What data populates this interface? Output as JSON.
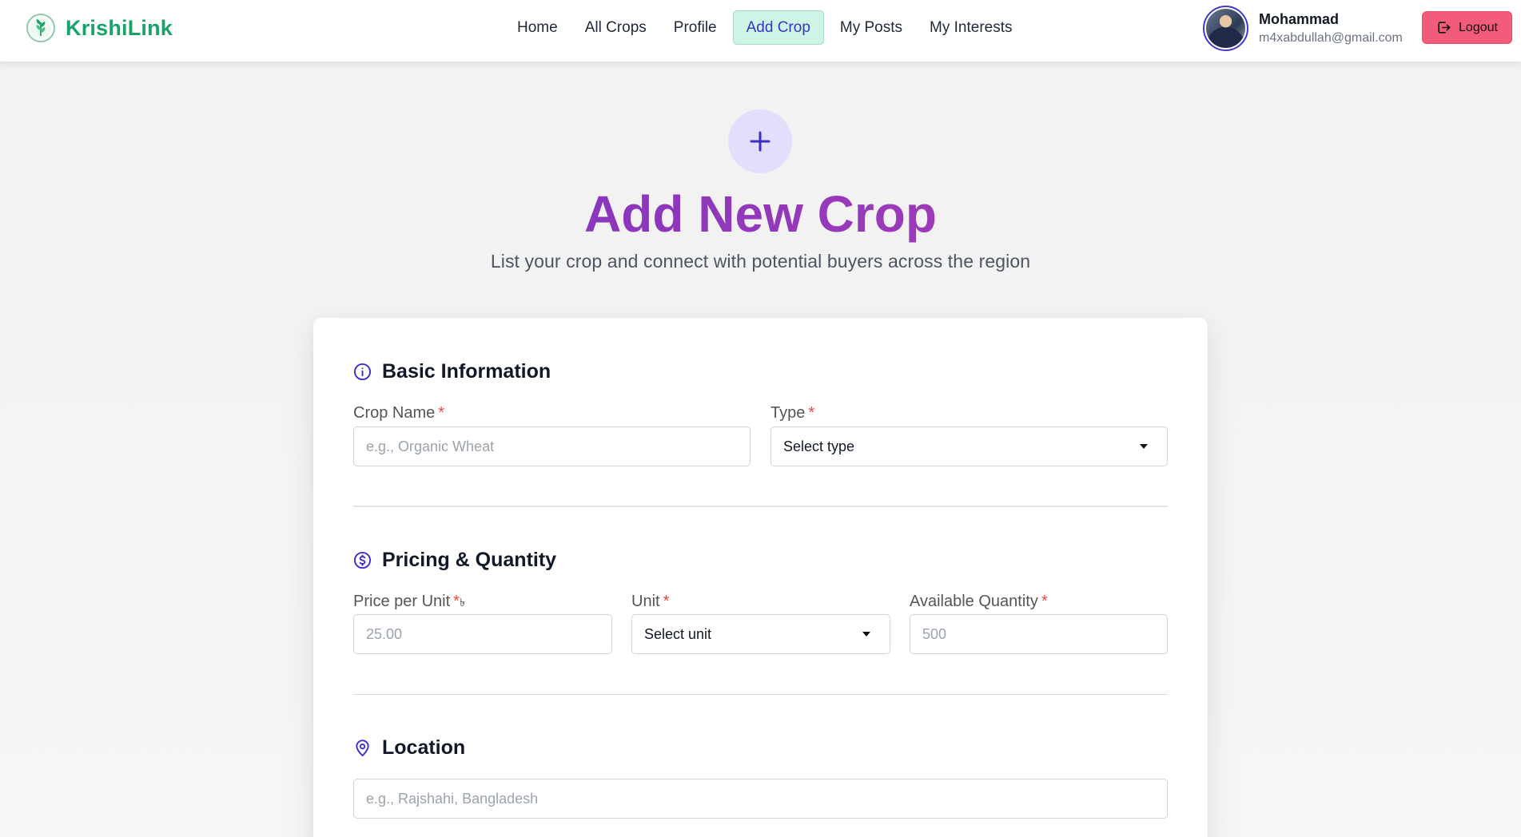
{
  "brand": {
    "name": "KrishiLink"
  },
  "nav": {
    "items": [
      {
        "label": "Home"
      },
      {
        "label": "All Crops"
      },
      {
        "label": "Profile"
      },
      {
        "label": "Add Crop"
      },
      {
        "label": "My Posts"
      },
      {
        "label": "My Interests"
      }
    ],
    "active": "Add Crop"
  },
  "user": {
    "name": "Mohammad",
    "email": "m4xabdullah@gmail.com",
    "logout_label": "Logout"
  },
  "hero": {
    "title": "Add New Crop",
    "subtitle": "List your crop and connect with potential buyers across the region"
  },
  "form": {
    "basic": {
      "title": "Basic Information",
      "crop_name_label": "Crop Name",
      "crop_name_placeholder": "e.g., Organic Wheat",
      "type_label": "Type",
      "type_value": "Select type"
    },
    "pricing": {
      "title": "Pricing & Quantity",
      "price_label": "Price per Unit",
      "currency": "৳",
      "price_placeholder": "25.00",
      "unit_label": "Unit",
      "unit_value": "Select unit",
      "quantity_label": "Available Quantity",
      "quantity_placeholder": "500"
    },
    "location": {
      "title": "Location",
      "placeholder": "e.g., Rajshahi, Bangladesh"
    },
    "required_mark": "*"
  },
  "colors": {
    "brand": "#1aa368",
    "accent": "#4338ca",
    "logout": "#f25b7a",
    "active_nav_bg": "#cdf4e4"
  },
  "icons": {
    "logo": "leaf-logo-icon",
    "add": "plus-icon",
    "basic": "info-circle-icon",
    "pricing": "dollar-circle-icon",
    "location": "map-pin-icon",
    "logout": "logout-icon"
  }
}
